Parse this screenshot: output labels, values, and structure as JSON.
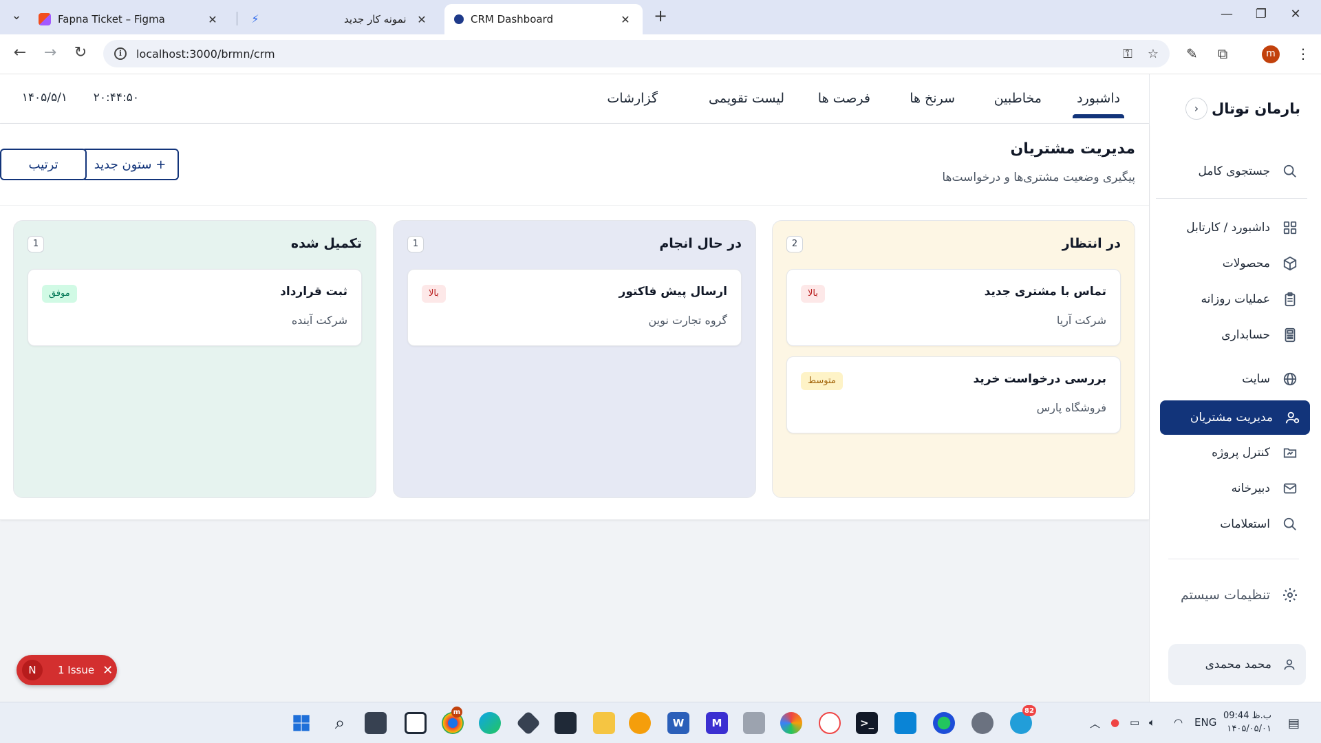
{
  "browser": {
    "tabs": [
      {
        "title": "Fapna Ticket – Figma",
        "favicon": "figma-icon",
        "color": "#f24e1e"
      },
      {
        "title": "نمونه کار جدید",
        "favicon": "bolt-icon",
        "color": "#2563eb"
      },
      {
        "title": "CRM Dashboard",
        "favicon": "app-icon",
        "color": "#1e3a8a"
      }
    ],
    "url": "localhost:3000/brmn/crm",
    "profile_initial": "m"
  },
  "app": {
    "brand": "بارمان توتال",
    "sidebar": {
      "items": [
        {
          "label": "جستجوی کامل",
          "icon": "search-icon"
        },
        {
          "label": "داشبورد / کارتابل",
          "icon": "grid-icon"
        },
        {
          "label": "محصولات",
          "icon": "box-icon"
        },
        {
          "label": "عملیات روزانه",
          "icon": "clipboard-icon"
        },
        {
          "label": "حسابداری",
          "icon": "calculator-icon"
        },
        {
          "label": "سایت",
          "icon": "globe-icon"
        },
        {
          "label": "مدیریت مشتریان",
          "icon": "user-settings-icon"
        },
        {
          "label": "کنترل پروژه",
          "icon": "folder-icon"
        },
        {
          "label": "دبیرخانه",
          "icon": "mail-icon"
        },
        {
          "label": "استعلامات",
          "icon": "search-icon"
        }
      ],
      "settings": "تنظیمات سیستم",
      "user_name": "محمد محمدی"
    },
    "topnav": {
      "tabs": [
        "داشبورد",
        "مخاطبین",
        "سرنخ ها",
        "فرصت ها",
        "لیست تقویمی",
        "گزارشات"
      ],
      "time": "۲۰:۴۴:۵۰",
      "date": "۱۴۰۵/۵/۱"
    },
    "page": {
      "title": "مدیریت مشتریان",
      "subtitle": "پیگیری وضعیت مشتری‌ها و درخواست‌ها",
      "new_column_button": "+ ستون جدید",
      "sort_button": "ترتیب"
    },
    "columns": [
      {
        "title": "در انتظار",
        "count": "2",
        "color": "#fdf6e4",
        "cards": [
          {
            "title": "تماس با مشتری جدید",
            "company": "شرکت آریا",
            "badge": "بالا",
            "badge_type": "high"
          },
          {
            "title": "بررسی درخواست خرید",
            "company": "فروشگاه پارس",
            "badge": "متوسط",
            "badge_type": "mid"
          }
        ]
      },
      {
        "title": "در حال انجام",
        "count": "1",
        "color": "#e6e9f4",
        "cards": [
          {
            "title": "ارسال پیش فاکتور",
            "company": "گروه تجارت نوین",
            "badge": "بالا",
            "badge_type": "high"
          }
        ]
      },
      {
        "title": "تکمیل شده",
        "count": "1",
        "color": "#e6f3ef",
        "cards": [
          {
            "title": "ثبت قرارداد",
            "company": "شرکت آینده",
            "badge": "موفق",
            "badge_type": "ok"
          }
        ]
      }
    ],
    "issue_indicator": {
      "initial": "N",
      "label": "1 Issue"
    }
  },
  "taskbar": {
    "lang": "ENG",
    "time": "09:44 ب.ظ",
    "date": "۱۴۰۵/۰۵/۰۱",
    "chrome_badge": "m",
    "telegram_badge": "82"
  },
  "colors": {
    "accent": "#12347a",
    "pending": "#fdf6e4",
    "progress": "#e6e9f4",
    "done": "#e6f3ef",
    "issue": "#d32f2f"
  }
}
